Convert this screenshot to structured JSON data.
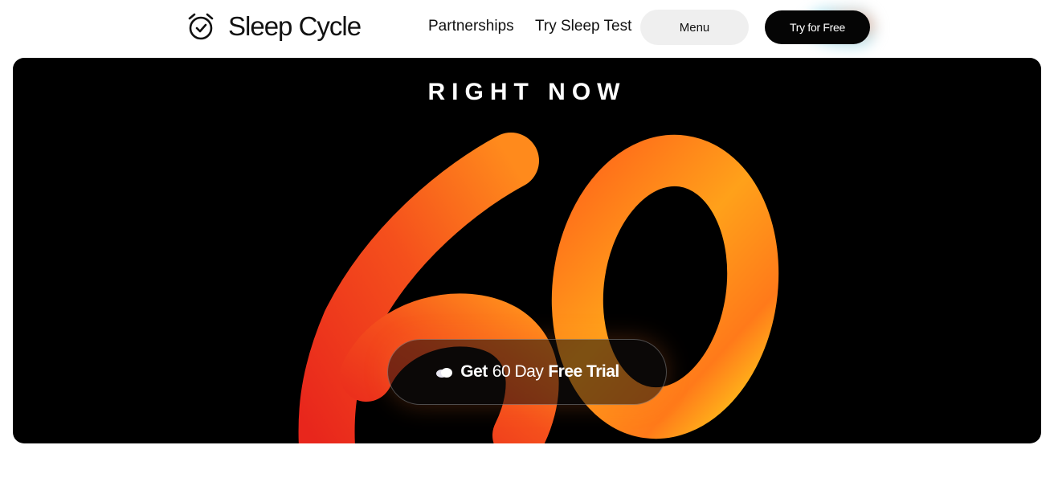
{
  "brand": {
    "name": "Sleep Cycle",
    "logo_icon": "alarm-clock-icon"
  },
  "nav": {
    "links": [
      {
        "label": "Partnerships"
      },
      {
        "label": "Try Sleep Test"
      }
    ],
    "menu_label": "Menu",
    "cta_label": "Try for Free"
  },
  "hero": {
    "eyebrow": "RIGHT NOW",
    "big_number": "60",
    "cta": {
      "icon": "cloud-icon",
      "part1": "Get",
      "part2": "60 Day",
      "part3": "Free Trial"
    }
  },
  "colors": {
    "hero_background": "#000000",
    "number_orange": "#ff7a1a",
    "number_red": "#e8261c",
    "number_yellow": "#ffc21a",
    "cta_button_bg": "#050505",
    "menu_button_bg": "#efefef"
  }
}
